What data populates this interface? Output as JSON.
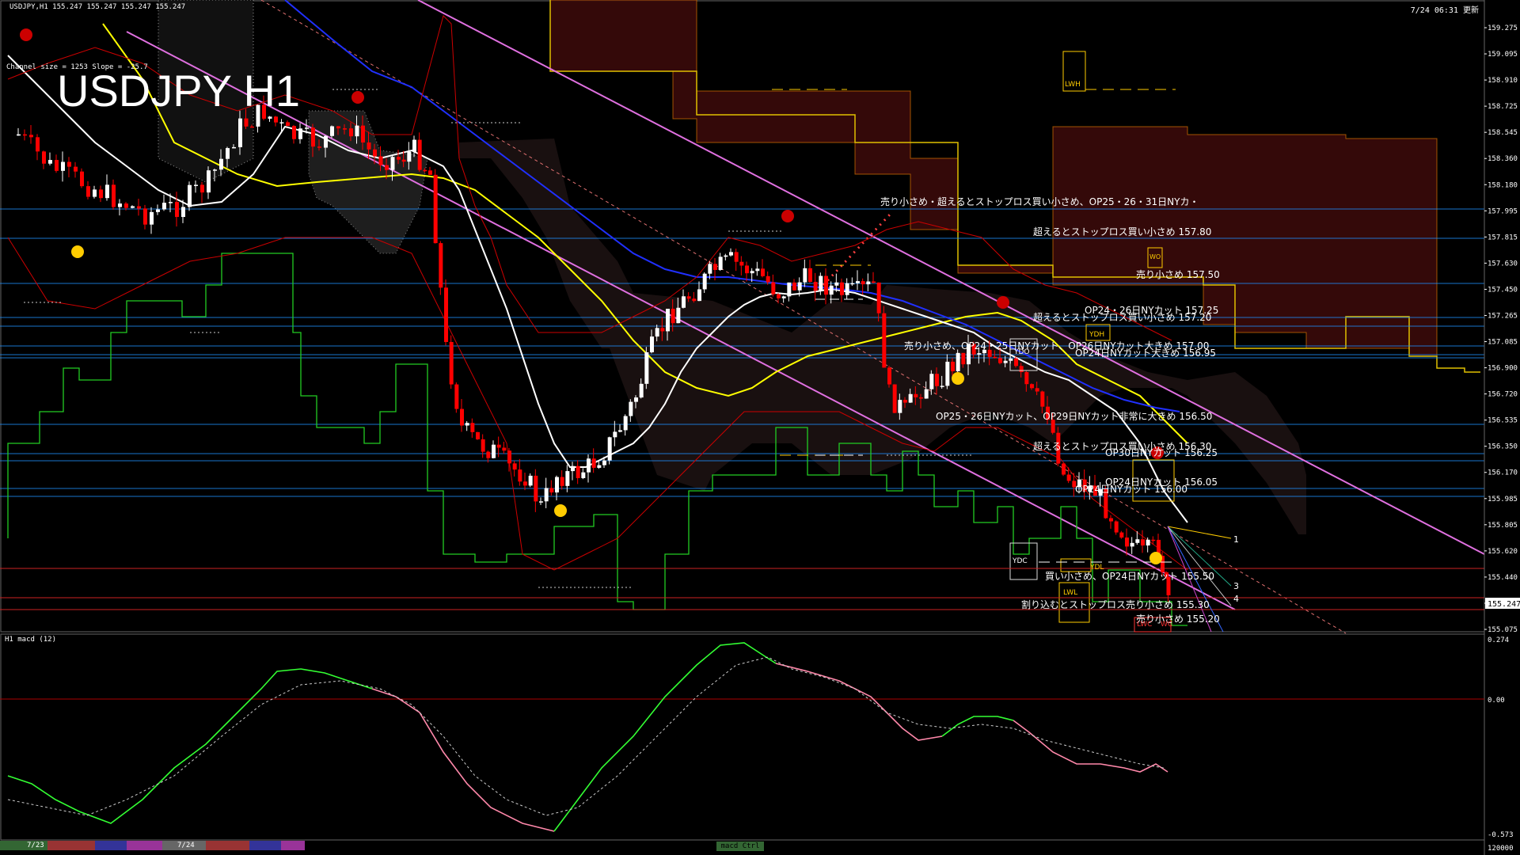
{
  "header": {
    "left": "USDJPY,H1  155.247 155.247 155.247 155.247",
    "right": "7/24 06:31 更新"
  },
  "big_title": "USDJPY H1",
  "channel_info": "Channel size = 1253 Slope = -25.7",
  "macd_label": "H1  macd (12)",
  "macd_button": "macd Ctrl",
  "colors": {
    "bg": "#000000",
    "up_candle": "#ffffff",
    "down_candle": "#ff0000",
    "grid_h": "#1e90ff",
    "channel": "#e070e0",
    "cloud": "#c8a0a0",
    "yellow": "#ffff00",
    "ma_white": "#ffffff",
    "ma_blue": "#2030ff",
    "bollinger": "#cc0000",
    "green": "#20cc20",
    "macd_main": "#33ff33",
    "macd_down": "#ff88aa"
  },
  "price_axis": {
    "ticks": [
      "159.275",
      "159.095",
      "158.910",
      "158.725",
      "158.545",
      "158.360",
      "158.180",
      "157.995",
      "157.815",
      "157.630",
      "157.450",
      "157.265",
      "157.085",
      "156.900",
      "156.720",
      "156.535",
      "156.350",
      "156.170",
      "155.985",
      "155.805",
      "155.620",
      "155.440",
      "155.255",
      "155.075"
    ],
    "current": "155.247"
  },
  "macd_axis": {
    "ticks": [
      "0.274",
      "0.00",
      "-0.573"
    ],
    "bottom": "120000"
  },
  "time_axis": {
    "ticks": [
      "7/23",
      "7/24"
    ]
  },
  "annotations": [
    {
      "text": "売り小さめ・超えるとストップロス買い小さめ、OP25・26・31日NYカ・"
    },
    {
      "text": "超えるとストップロス買い小さめ 157.80"
    },
    {
      "text": "売り小さめ 157.50"
    },
    {
      "text": "OP24・26日NYカット 157.25"
    },
    {
      "text": "超えるとストップロス買い小さめ 157.20"
    },
    {
      "text": "売り小さめ、OP24・25日NYカット、OP26日NYカット大きめ 157.00"
    },
    {
      "text": "OP24日NYカット大きめ 156.95"
    },
    {
      "text": "OP25・26日NYカット、OP29日NYカット非常に大きめ 156.50"
    },
    {
      "text": "超えるとストップロス買い小さめ 156.30"
    },
    {
      "text": "OP30日NYカット 156.25"
    },
    {
      "text": "OP24日NYカット 156.05"
    },
    {
      "text": "OP24日NYカット 156.00"
    },
    {
      "text": "買い小さめ、OP24日NYカット 155.50"
    },
    {
      "text": "割り込むとストップロス売り小さめ 155.30"
    },
    {
      "text": "売り小さめ 155.20"
    }
  ],
  "markers": [
    "LWH",
    "YDH",
    "YDO",
    "YDC",
    "YDL",
    "LWL",
    "LWC",
    "WC",
    "WO"
  ],
  "channel_numbers": [
    "1",
    "3",
    "4"
  ]
}
